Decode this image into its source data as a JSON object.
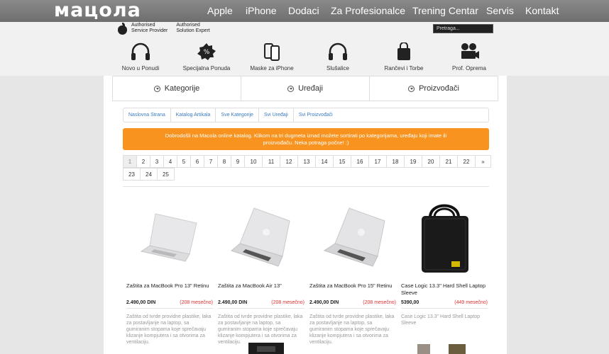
{
  "header": {
    "logo": "мацола",
    "nav": [
      "Apple",
      "iPhone",
      "Dodaci",
      "Za Profesionalce",
      "Trening Centar",
      "Servis",
      "Kontakt"
    ]
  },
  "badges": [
    {
      "line1": "Authorised",
      "line2": "Service Provider"
    },
    {
      "line1": "Authorised",
      "line2": "Solution Expert"
    }
  ],
  "search": {
    "placeholder": "Pretraga..."
  },
  "categories": [
    {
      "label": "Novo u Ponudi",
      "icon": "headphones-icon"
    },
    {
      "label": "Specijalna Ponuda",
      "icon": "percent-badge-icon"
    },
    {
      "label": "Maske za iPhone",
      "icon": "phone-case-icon"
    },
    {
      "label": "Slušalice",
      "icon": "headphones-icon"
    },
    {
      "label": "Rančevi i Torbe",
      "icon": "bag-icon"
    },
    {
      "label": "Prof. Oprema",
      "icon": "camera-icon"
    }
  ],
  "tabs": [
    "Kategorije",
    "Uređaji",
    "Proizvođači"
  ],
  "breadcrumb": [
    "Naslovna Strana",
    "Katalog Artikala",
    "Sve Kategorije",
    "Svi Uređaji",
    "Svi Proizvođači"
  ],
  "notice": "Dobrodošli na Macola online katalog. Klikom na tri dugmeta iznad možete sortirati po kategorijama, uređaju koji imate ili proizvođaču. Neka potraga počne! :)",
  "pagination": {
    "row1": [
      "1",
      "2",
      "3",
      "4",
      "5",
      "6",
      "7",
      "8",
      "9",
      "10",
      "11",
      "12",
      "13",
      "14",
      "15",
      "16",
      "17",
      "18",
      "19",
      "20",
      "21",
      "22",
      "»"
    ],
    "row2": [
      "23",
      "24",
      "25"
    ],
    "current": "1"
  },
  "products": [
    {
      "name": "Zaštita za MacBook Pro 13\" Retinu",
      "price": "2.490,00 DIN",
      "monthly": "(208 mesečno)",
      "desc": "Zaštita od tvrde providne plastike, laka za postavljanje na laptop, sa gumiranim stopama koje sprečavaju klizanje kompjutera i sa otvorima za ventilaciju."
    },
    {
      "name": "Zaštita za MacBook Air 13\"",
      "price": "2.490,00 DIN",
      "monthly": "(208 mesečno)",
      "desc": "Zaštita od tvrde providne plastike, laka za postavljanje na laptop, sa gumiranim stopama koje sprečavaju klizanje kompjutera i sa otvorima za ventilaciju."
    },
    {
      "name": "Zaštita za MacBook Pro 15\" Retinu",
      "price": "2.490,00 DIN",
      "monthly": "(208 mesečno)",
      "desc": "Zaštita od tvrde providne plastike, laka za postavljanje na laptop, sa gumiranim stopama koje sprečavaju klizanje kompjutera i sa otvorima za ventilaciju."
    },
    {
      "name": "Case Logic 13.3\" Hard Shell Laptop Sleeve",
      "price": "5390,00",
      "monthly": "(449 mesečno)",
      "desc": "Case Logic 13.3\" Hard Shell Laptop Sleeve"
    }
  ]
}
